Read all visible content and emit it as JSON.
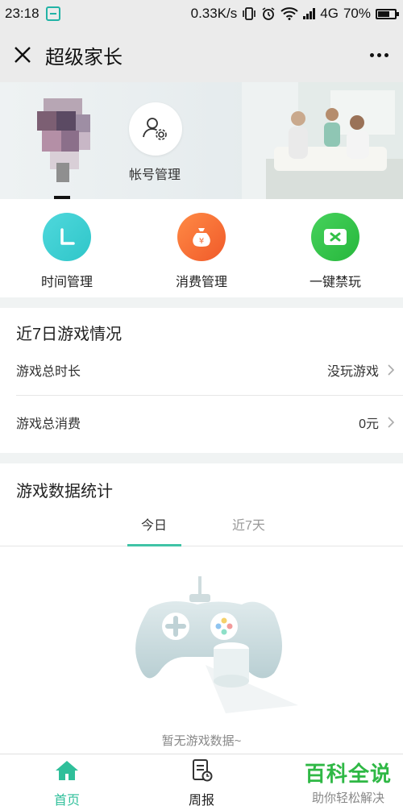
{
  "status_bar": {
    "time": "23:18",
    "network_speed": "0.33K/s",
    "network_type": "4G",
    "battery": "70%"
  },
  "nav": {
    "title": "超级家长",
    "close_icon": "close-icon",
    "more_icon": "more-icon"
  },
  "banner": {
    "account_label": "帐号管理"
  },
  "quick_actions": [
    {
      "label": "时间管理",
      "icon": "clock-icon",
      "color": "#3fd3d6"
    },
    {
      "label": "消费管理",
      "icon": "money-bag-icon",
      "color": "#f46a33"
    },
    {
      "label": "一键禁玩",
      "icon": "ban-play-icon",
      "color": "#33c44a"
    }
  ],
  "week_summary": {
    "title": "近7日游戏情况",
    "rows": [
      {
        "label": "游戏总时长",
        "value": "没玩游戏"
      },
      {
        "label": "游戏总消费",
        "value": "0元"
      }
    ]
  },
  "stats": {
    "title": "游戏数据统计",
    "tabs": [
      "今日",
      "近7天"
    ],
    "empty_text": "暂无游戏数据~"
  },
  "bottom_nav": [
    {
      "label": "首页",
      "icon": "home-icon"
    },
    {
      "label": "周报",
      "icon": "report-icon"
    }
  ],
  "watermark": {
    "main": "百科全说",
    "sub": "助你轻松解决"
  },
  "colors": {
    "accent": "#40c3a6",
    "bar_bg": "#ebebeb"
  }
}
